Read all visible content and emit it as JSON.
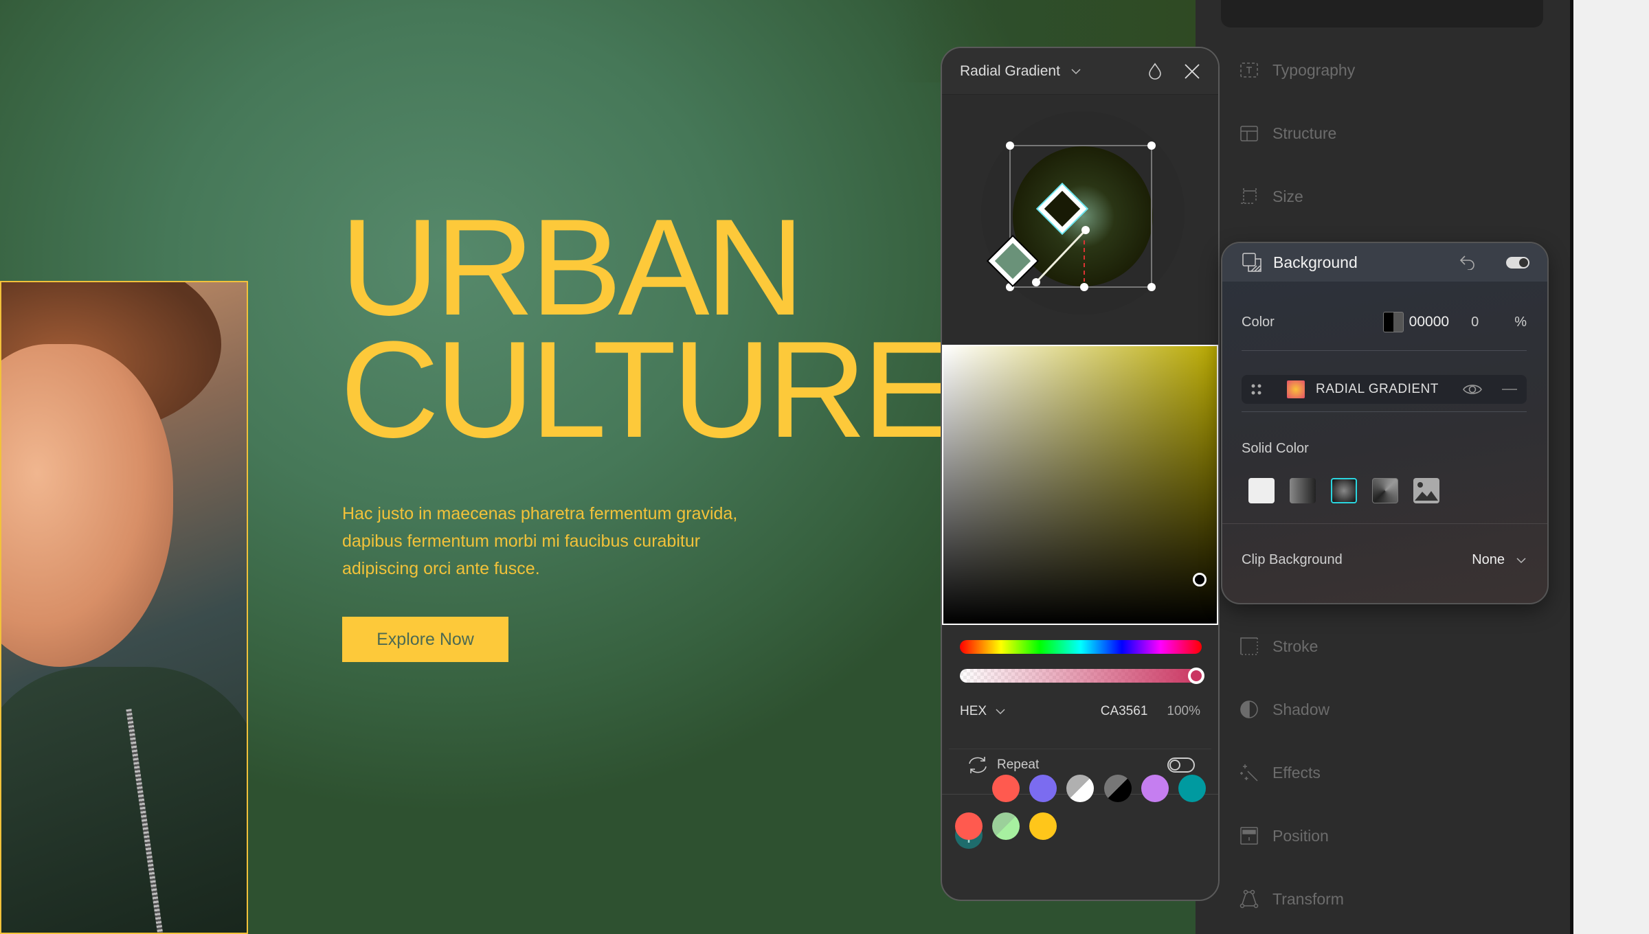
{
  "hero": {
    "title_line1": "URBAN",
    "title_line2": "CULTURE",
    "paragraph": "Hac justo in maecenas pharetra fermentum gravida, dapibus fermentum morbi mi faucibus curabitur adipiscing orci ante fusce.",
    "cta_label": "Explore Now",
    "accent": "#fdc93a"
  },
  "gradient_panel": {
    "type_label": "Radial Gradient",
    "format_label": "HEX",
    "hex_value": "CA3561",
    "opacity": "100%",
    "repeat_label": "Repeat",
    "repeat_on": false,
    "alpha_level": 1.0,
    "swatches": [
      "#ff5a4f",
      "#7b6cf0",
      "#ffffff/#b0b0b0",
      "#000000/#777777",
      "#c57ef0",
      "#009aa0",
      "#ff5a4f",
      "#a7f0a0/#9bd09a",
      "#ffc61a"
    ]
  },
  "background_panel": {
    "title": "Background",
    "enabled": true,
    "color_label": "Color",
    "color_hex": "00000",
    "color_opacity": "0",
    "percent_sign": "%",
    "layer_label": "RADIAL GRADIENT",
    "solid_color_label": "Solid Color",
    "clip_label": "Clip Background",
    "clip_value": "None"
  },
  "sidebar": {
    "items": [
      "Typography",
      "Structure",
      "Size",
      "Stroke",
      "Shadow",
      "Effects",
      "Position",
      "Transform"
    ]
  }
}
